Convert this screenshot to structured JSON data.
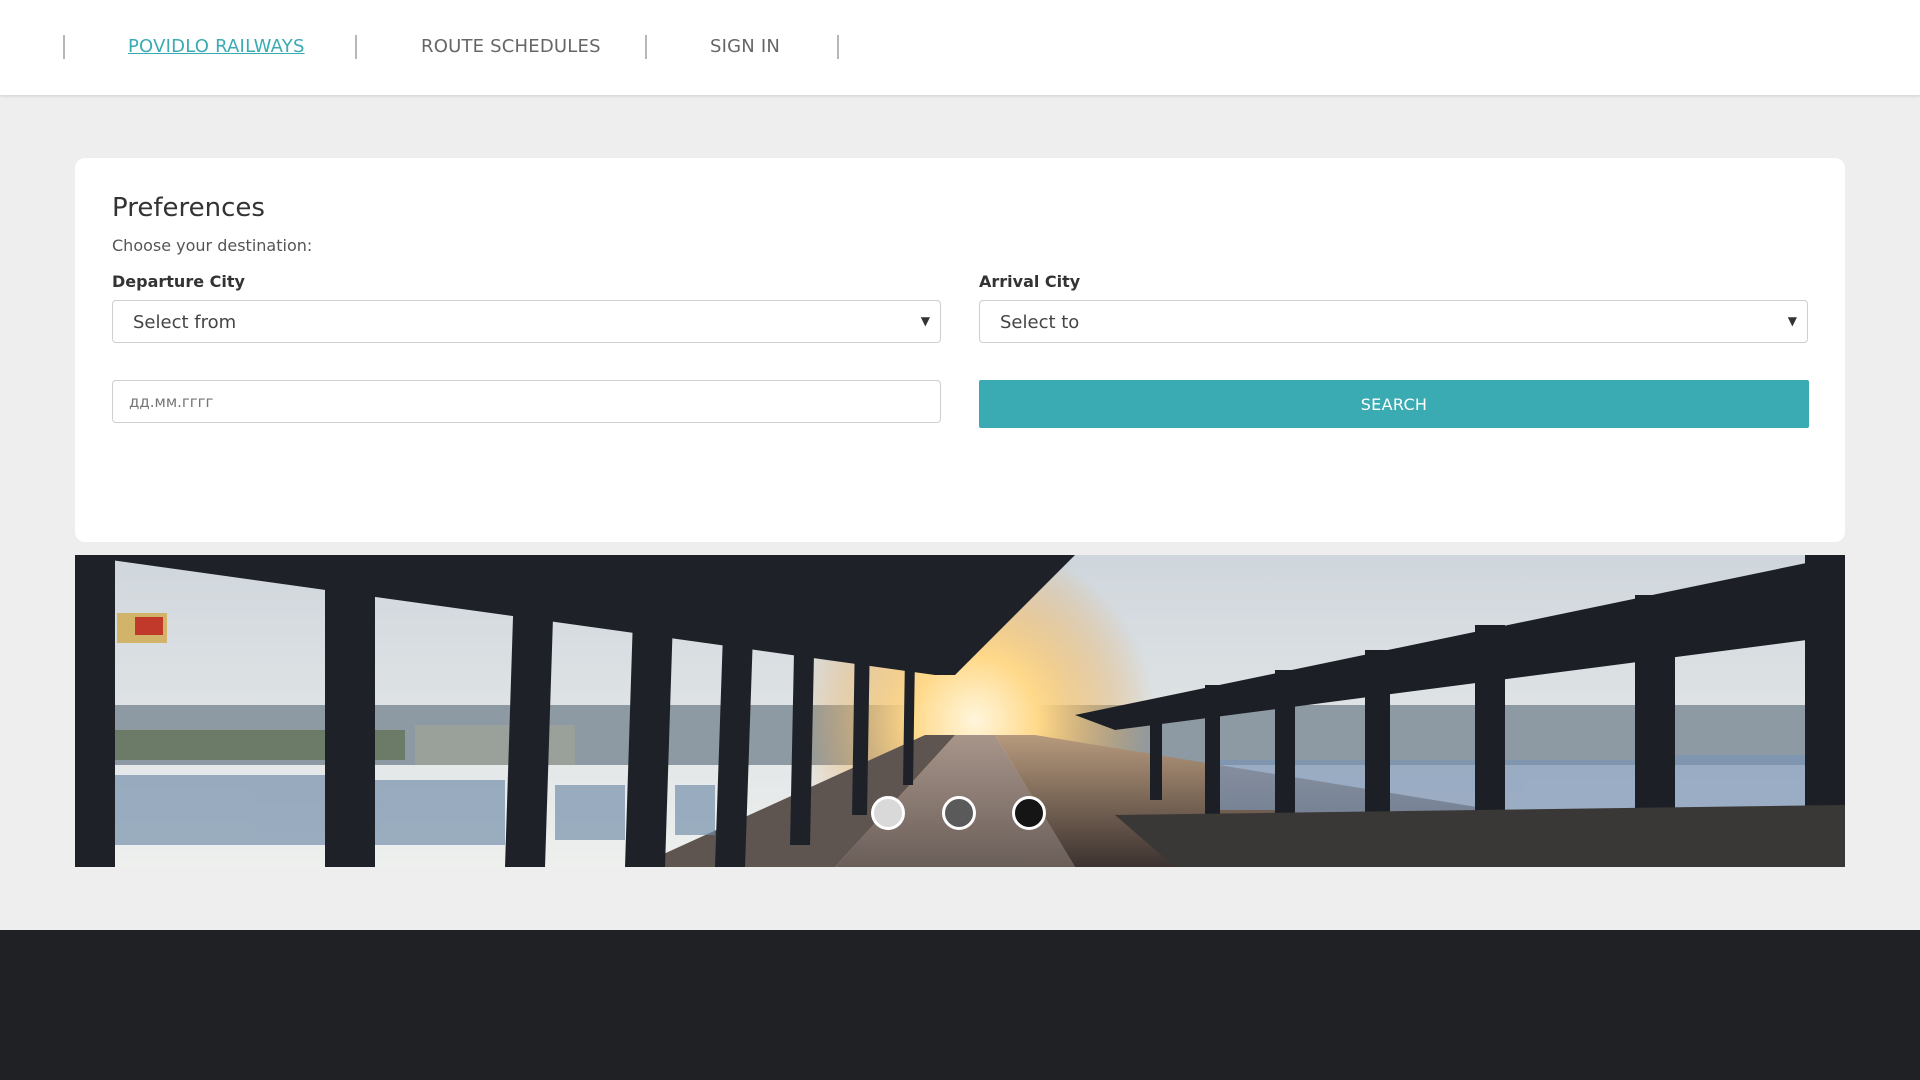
{
  "nav": {
    "brand": "POVIDLO RAILWAYS",
    "links": [
      "ROUTE SCHEDULES",
      "SIGN IN"
    ]
  },
  "preferences": {
    "title": "Preferences",
    "subtitle": "Choose your destination:",
    "departure": {
      "label": "Departure City",
      "value": "Select from"
    },
    "arrival": {
      "label": "Arrival City",
      "value": "Select to"
    },
    "date": {
      "placeholder": "дд.мм.гггг"
    },
    "search_label": "SEARCH"
  },
  "carousel": {
    "slide_count": 3,
    "active_index": 0,
    "dot_colors": [
      "#d9d9d9",
      "#5a5a5a",
      "#151515"
    ]
  },
  "colors": {
    "accent": "#3aabb2",
    "background": "#eeeeee",
    "footer": "#202125"
  }
}
